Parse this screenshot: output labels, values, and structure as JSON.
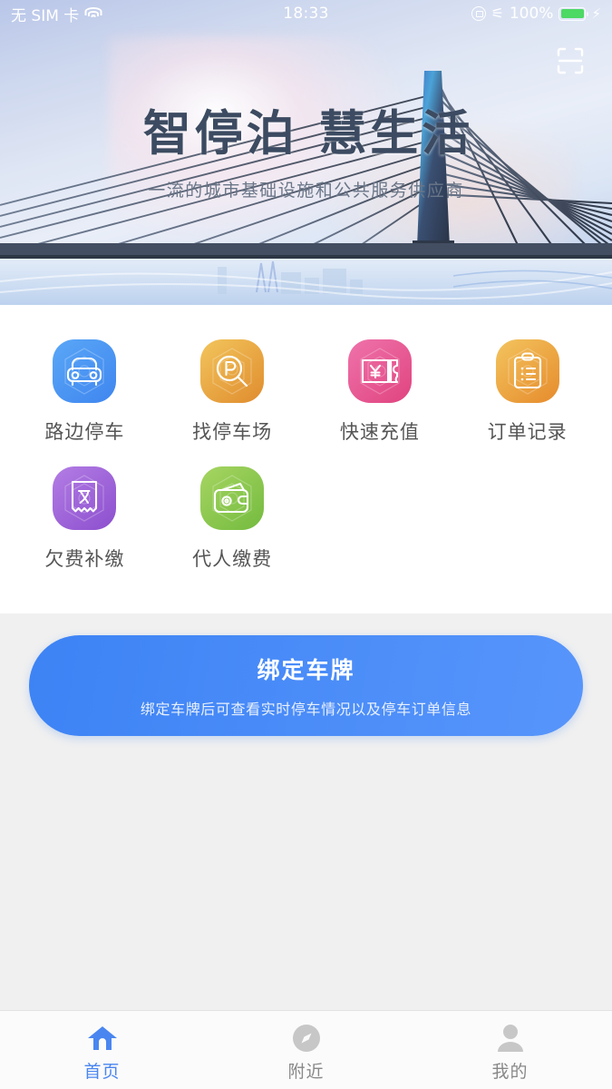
{
  "status_bar": {
    "carrier": "无 SIM 卡",
    "wifi_icon": "wifi-icon",
    "time": "18:33",
    "rotation_lock_icon": "rotation-lock-icon",
    "bluetooth_icon": "bluetooth-icon",
    "battery_percent": "100%",
    "battery_icon": "battery-full-icon",
    "charging_icon": "charging-bolt-icon"
  },
  "hero": {
    "title": "智停泊 慧生活",
    "subtitle": "一流的城市基础设施和公共服务供应商",
    "scan_icon": "scan-qr-icon",
    "title_color": "#3c4b61",
    "subtitle_color": "#6a7688"
  },
  "grid": {
    "items": [
      {
        "label": "路边停车",
        "icon": "car-icon",
        "color_start": "#5aa7f7",
        "color_end": "#3f86ef"
      },
      {
        "label": "找停车场",
        "icon": "parking-search-icon",
        "color_start": "#f2c55c",
        "color_end": "#e08c2e"
      },
      {
        "label": "快速充值",
        "icon": "recharge-ticket-icon",
        "color_start": "#ef73ab",
        "color_end": "#e0447f"
      },
      {
        "label": "订单记录",
        "icon": "clipboard-icon",
        "color_start": "#f3c45e",
        "color_end": "#e68b2c"
      },
      {
        "label": "欠费补缴",
        "icon": "overdue-receipt-icon",
        "color_start": "#b37de4",
        "color_end": "#8c4fce"
      },
      {
        "label": "代人缴费",
        "icon": "wallet-icon",
        "color_start": "#a6d562",
        "color_end": "#74bb3f"
      }
    ]
  },
  "bind_card": {
    "title": "绑定车牌",
    "subtitle": "绑定车牌后可查看实时停车情况以及停车订单信息",
    "accent_color": "#4a8cf8"
  },
  "tabbar": {
    "items": [
      {
        "label": "首页",
        "icon": "home-icon",
        "active": true
      },
      {
        "label": "附近",
        "icon": "compass-icon",
        "active": false
      },
      {
        "label": "我的",
        "icon": "person-icon",
        "active": false
      }
    ],
    "active_color": "#4a86f0",
    "inactive_color": "#888888"
  }
}
